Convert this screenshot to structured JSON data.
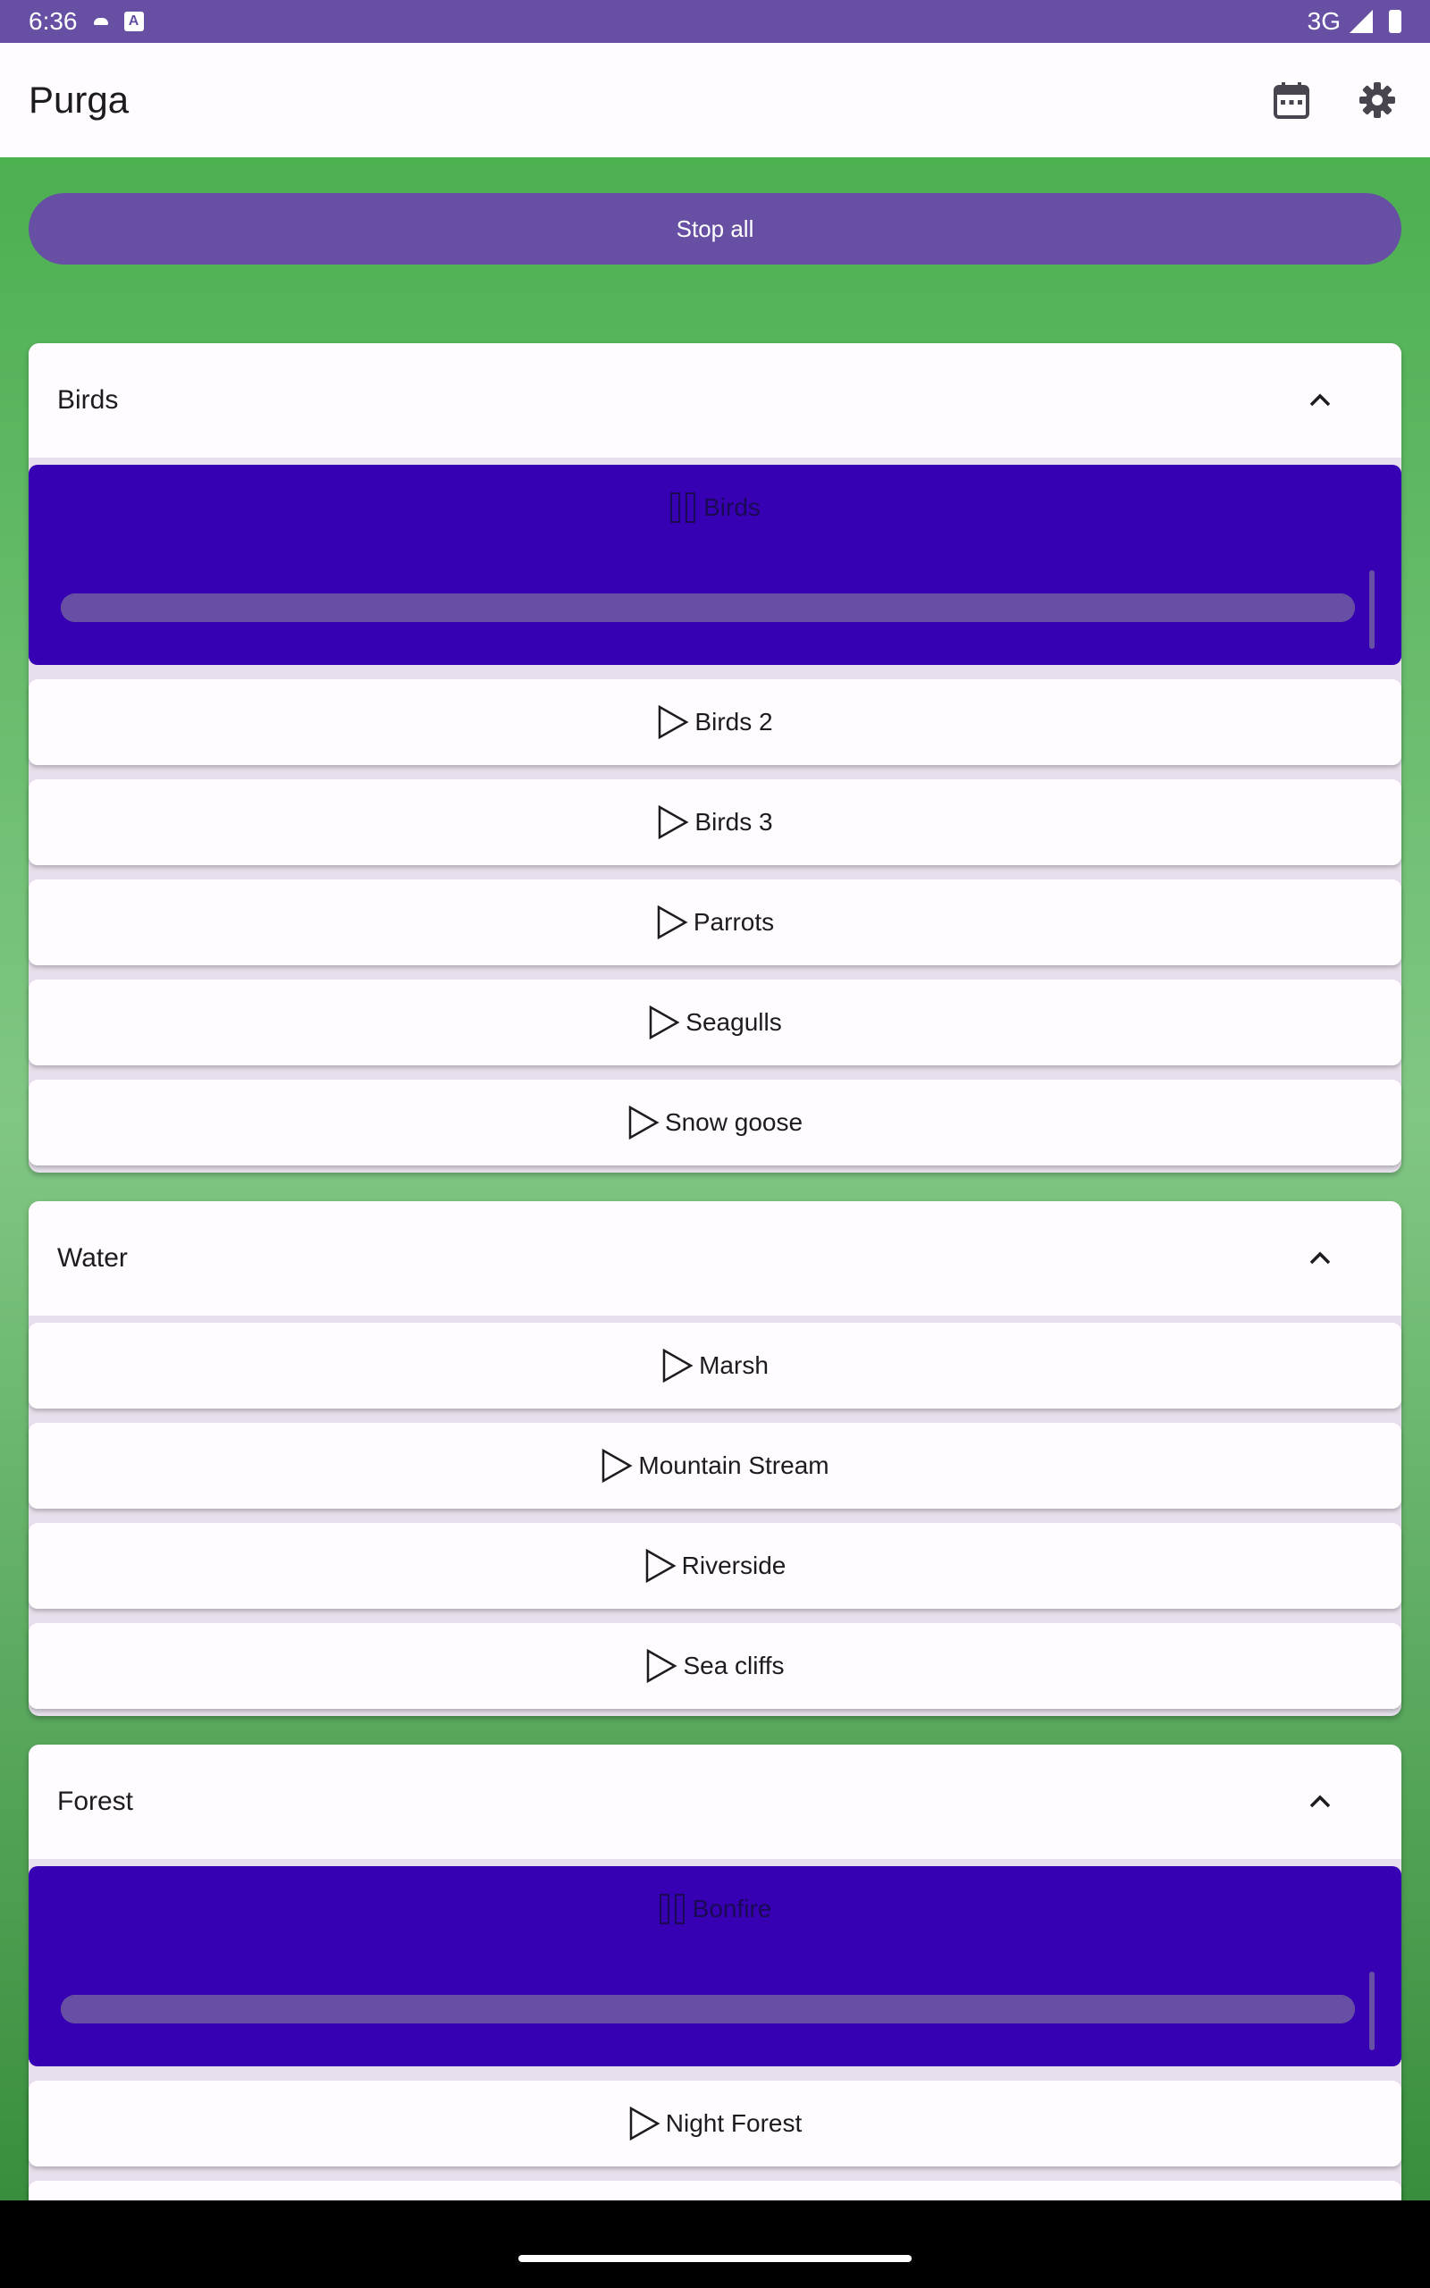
{
  "status_bar": {
    "time": "6:36",
    "network": "3G"
  },
  "app_bar": {
    "title": "Purga",
    "actions": [
      "calendar-icon",
      "gear-icon"
    ]
  },
  "stop_all_label": "Stop all",
  "categories": [
    {
      "title": "Birds",
      "expanded": true,
      "sounds": [
        {
          "label": "Birds",
          "playing": true,
          "volume": 1.0
        },
        {
          "label": "Birds 2",
          "playing": false
        },
        {
          "label": "Birds 3",
          "playing": false
        },
        {
          "label": "Parrots",
          "playing": false
        },
        {
          "label": "Seagulls",
          "playing": false
        },
        {
          "label": "Snow goose",
          "playing": false
        }
      ]
    },
    {
      "title": "Water",
      "expanded": true,
      "sounds": [
        {
          "label": "Marsh",
          "playing": false
        },
        {
          "label": "Mountain Stream",
          "playing": false
        },
        {
          "label": "Riverside",
          "playing": false
        },
        {
          "label": "Sea cliffs",
          "playing": false
        }
      ]
    },
    {
      "title": "Forest",
      "expanded": true,
      "sounds": [
        {
          "label": "Bonfire",
          "playing": true,
          "volume": 1.0
        },
        {
          "label": "Night Forest",
          "playing": false
        }
      ]
    }
  ],
  "colors": {
    "primary": "#6750a4",
    "playing_card": "#3700b3",
    "surface": "#fffbfe",
    "background_green": "#4caf50"
  }
}
